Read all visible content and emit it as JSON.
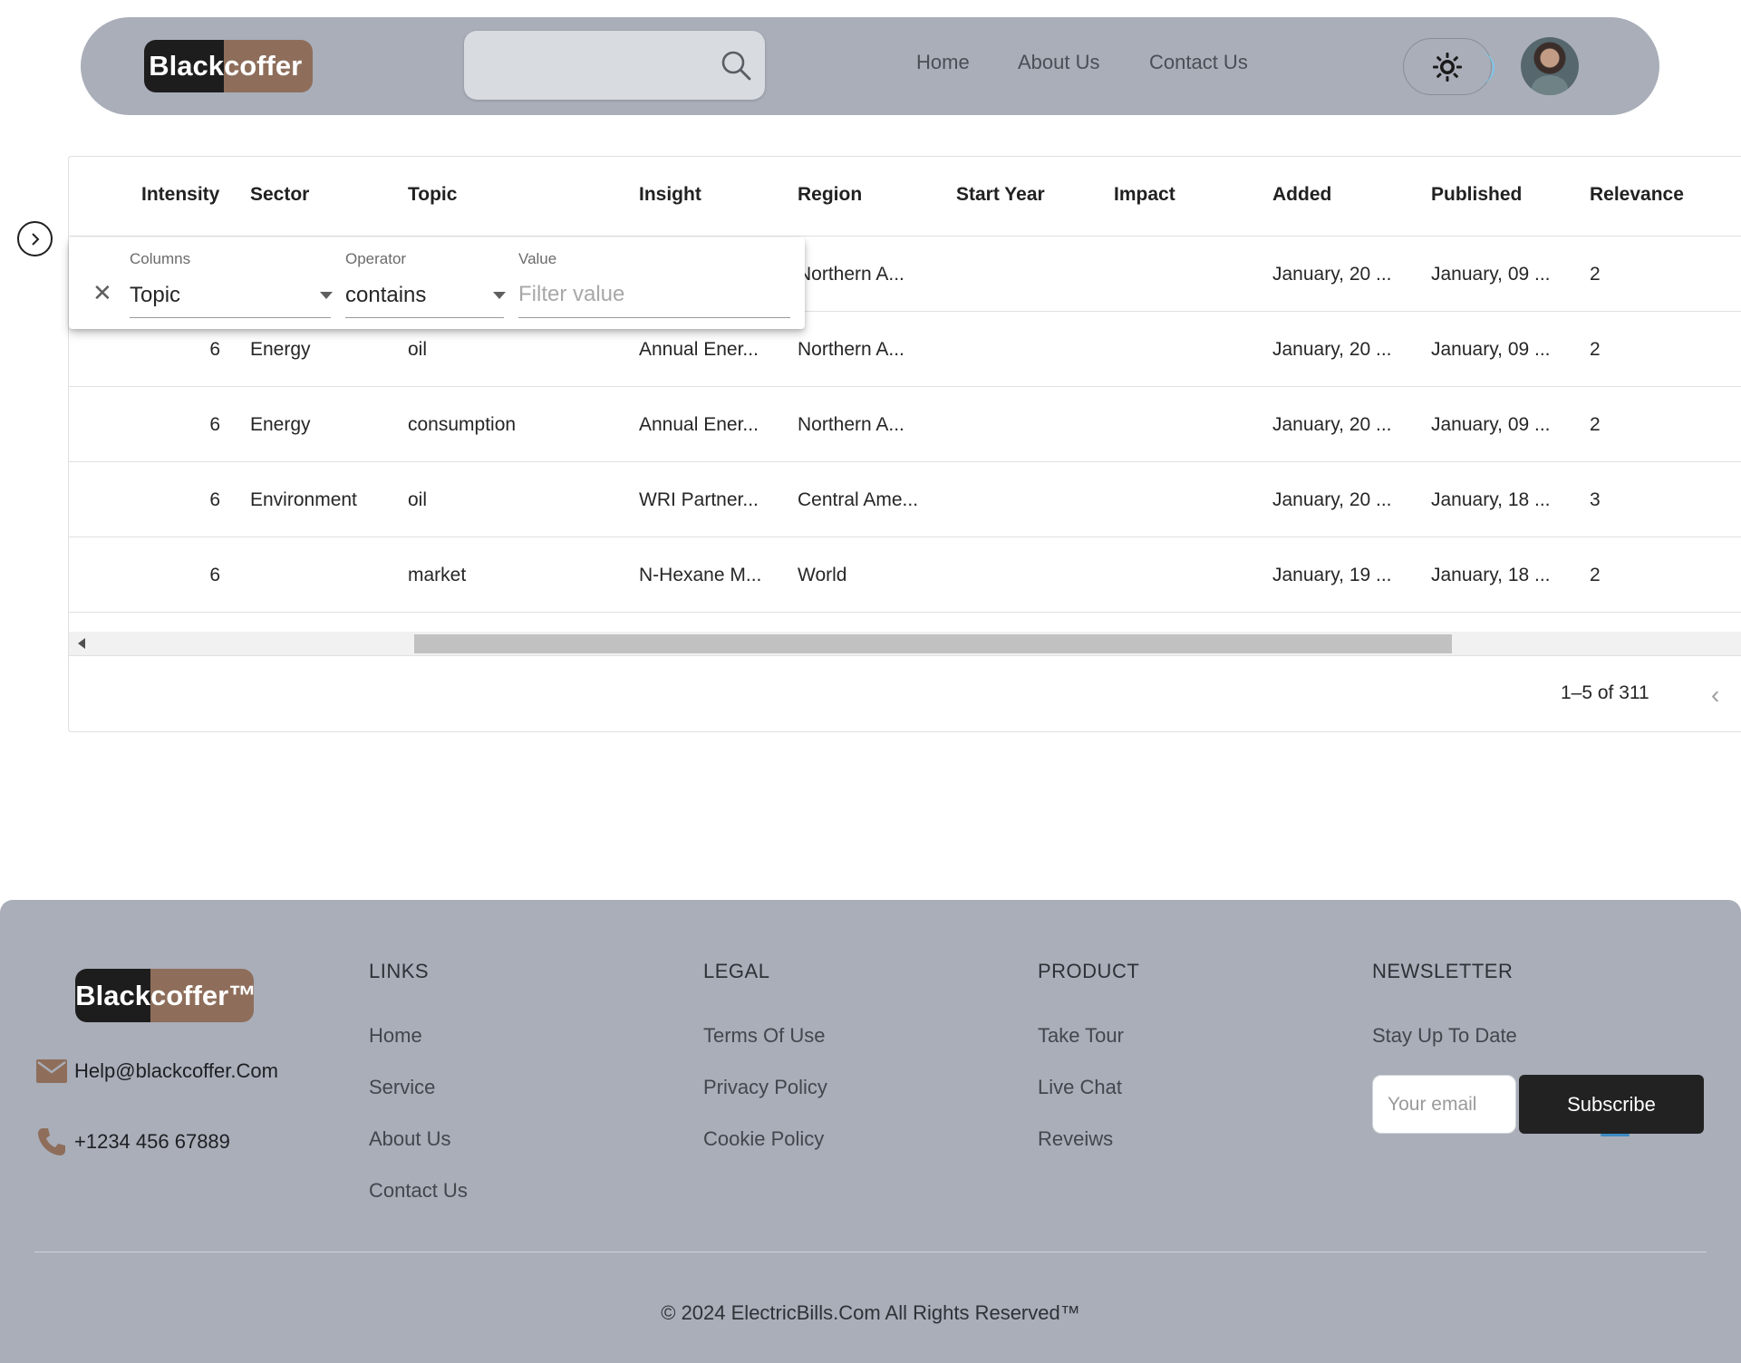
{
  "header": {
    "logo": {
      "part1": "Black",
      "part2": "coffer"
    },
    "search": {
      "placeholder": ""
    },
    "nav": [
      "Home",
      "About Us",
      "Contact Us"
    ]
  },
  "grid": {
    "columns": [
      "Intensity",
      "Sector",
      "Topic",
      "Insight",
      "Region",
      "Start Year",
      "Impact",
      "Added",
      "Published",
      "Relevance"
    ],
    "rows": [
      {
        "intensity": "",
        "sector": "",
        "topic": "",
        "insight": "",
        "region": "Northern A...",
        "start_year": "",
        "impact": "",
        "added": "January, 20 ...",
        "published": "January, 09 ...",
        "relevance": "2"
      },
      {
        "intensity": "6",
        "sector": "Energy",
        "topic": "oil",
        "insight": "Annual Ener...",
        "region": "Northern A...",
        "start_year": "",
        "impact": "",
        "added": "January, 20 ...",
        "published": "January, 09 ...",
        "relevance": "2"
      },
      {
        "intensity": "6",
        "sector": "Energy",
        "topic": "consumption",
        "insight": "Annual Ener...",
        "region": "Northern A...",
        "start_year": "",
        "impact": "",
        "added": "January, 20 ...",
        "published": "January, 09 ...",
        "relevance": "2"
      },
      {
        "intensity": "6",
        "sector": "Environment",
        "topic": "oil",
        "insight": "WRI Partner...",
        "region": "Central Ame...",
        "start_year": "",
        "impact": "",
        "added": "January, 20 ...",
        "published": "January, 18 ...",
        "relevance": "3"
      },
      {
        "intensity": "6",
        "sector": "",
        "topic": "market",
        "insight": "N-Hexane M...",
        "region": "World",
        "start_year": "",
        "impact": "",
        "added": "January, 19 ...",
        "published": "January, 18 ...",
        "relevance": "2"
      }
    ],
    "pagination": "1–5 of 311",
    "pager_prev": "‹"
  },
  "filter_panel": {
    "columns_label": "Columns",
    "columns_value": "Topic",
    "operator_label": "Operator",
    "operator_value": "contains",
    "value_label": "Value",
    "value_placeholder": "Filter value",
    "close": "✕"
  },
  "footer": {
    "logo": {
      "part1": "Black",
      "part2": "coffer™"
    },
    "email": "Help@blackcoffer.Com",
    "phone": "+1234 456 67889",
    "links": {
      "title": "LINKS",
      "items": [
        "Home",
        "Service",
        "About Us",
        "Contact Us"
      ]
    },
    "legal": {
      "title": "LEGAL",
      "items": [
        "Terms Of Use",
        "Privacy Policy",
        "Cookie Policy"
      ]
    },
    "product": {
      "title": "PRODUCT",
      "items": [
        "Take Tour",
        "Live Chat",
        "Reveiws"
      ]
    },
    "newsletter": {
      "title": "NEWSLETTER",
      "subtitle": "Stay Up To Date",
      "email_placeholder": "Your email",
      "button": "Subscribe"
    },
    "copyright": "© 2024 ElectricBills.Com All Rights Reserved™"
  },
  "colors": {
    "header_bg": "#a9aeb9",
    "logo_dark": "#1d1d1d",
    "logo_brown": "#8e6e5b",
    "accent_blue": "#7dc6ea",
    "button_dark": "#222222",
    "contact_icon": "#8e6e5b"
  },
  "icons": {
    "search": "search-icon",
    "theme": "sun-icon",
    "side_toggle": "chevron-right-icon",
    "filter_close": "close-icon",
    "email": "mail-icon",
    "phone": "phone-icon"
  }
}
